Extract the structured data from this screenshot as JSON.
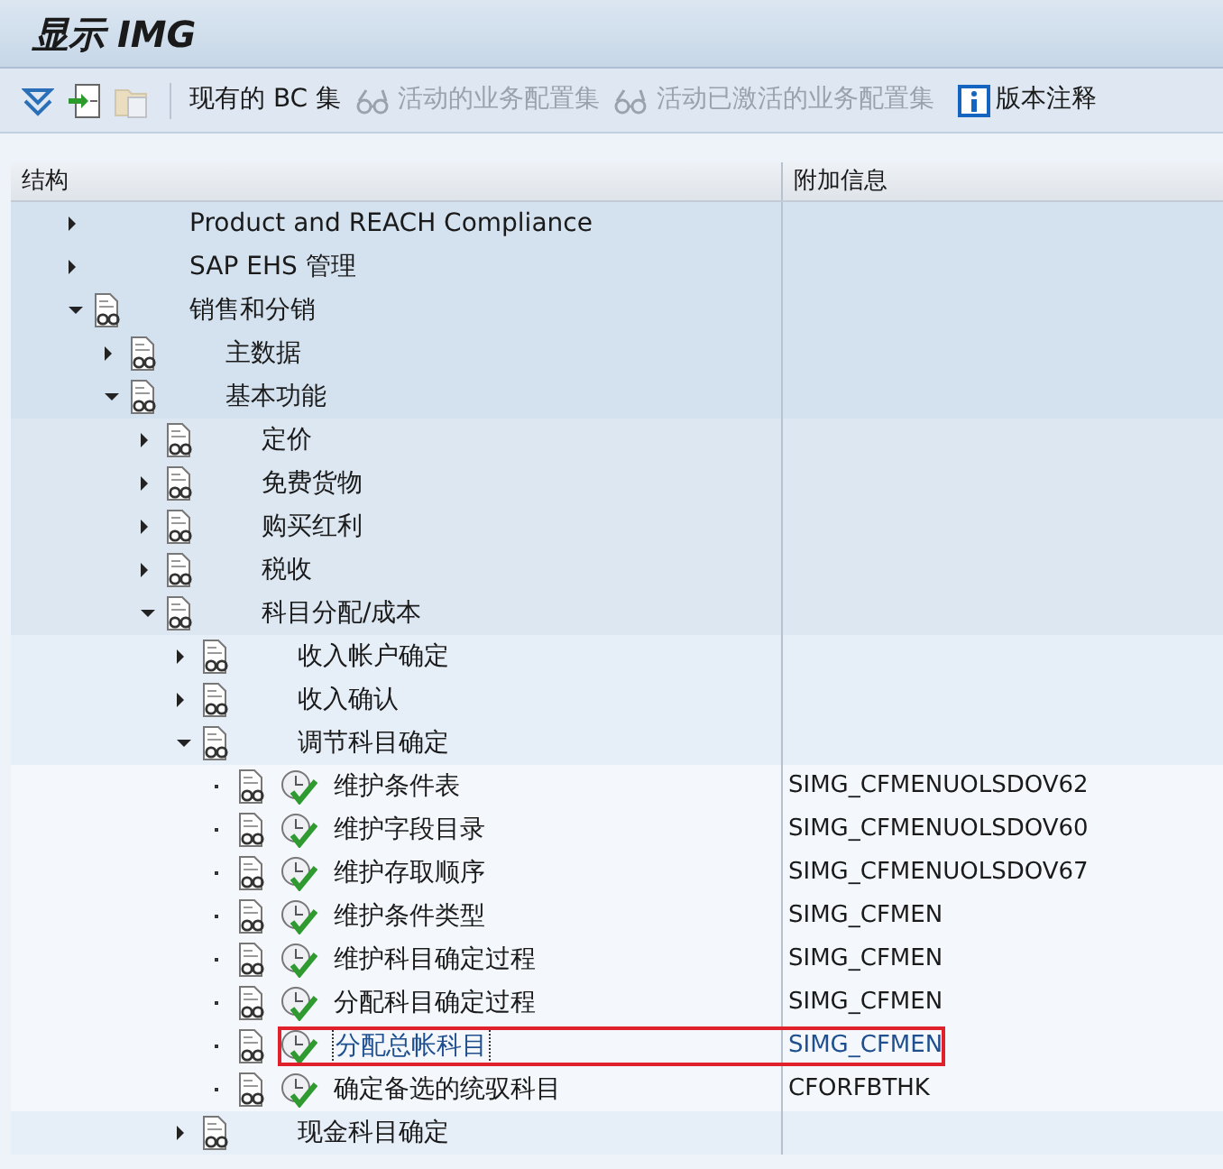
{
  "window": {
    "title": "显示 IMG"
  },
  "toolbar": {
    "buttons": [
      {
        "kind": "expand",
        "disabled": false
      },
      {
        "kind": "enter",
        "disabled": false
      },
      {
        "kind": "folder",
        "disabled": true
      }
    ],
    "actions": [
      {
        "label": "现有的 BC 集",
        "kind": "plain",
        "disabled": false
      },
      {
        "label": "活动的业务配置集",
        "kind": "glasses",
        "disabled": true
      },
      {
        "label": "活动已激活的业务配置集",
        "kind": "glasses",
        "disabled": true
      },
      {
        "label": "版本注释",
        "kind": "info",
        "disabled": false
      }
    ]
  },
  "table": {
    "columns": [
      "结构",
      "附加信息"
    ],
    "rows": [
      {
        "label": "Product and REACH Compliance",
        "kind": "plain",
        "expanded": false
      },
      {
        "label": "SAP EHS 管理",
        "kind": "plain",
        "expanded": false
      },
      {
        "label": "销售和分销",
        "kind": "folder",
        "expanded": true,
        "children": [
          {
            "label": "主数据",
            "kind": "folder",
            "expanded": false
          },
          {
            "label": "基本功能",
            "kind": "folder",
            "expanded": true,
            "children": [
              {
                "label": "定价",
                "kind": "folder",
                "expanded": false
              },
              {
                "label": "免费货物",
                "kind": "folder",
                "expanded": false
              },
              {
                "label": "购买红利",
                "kind": "folder",
                "expanded": false
              },
              {
                "label": "税收",
                "kind": "folder",
                "expanded": false
              },
              {
                "label": "科目分配/成本",
                "kind": "folder",
                "expanded": true,
                "children": [
                  {
                    "label": "收入帐户确定",
                    "kind": "folder",
                    "expanded": false
                  },
                  {
                    "label": "收入确认",
                    "kind": "folder",
                    "expanded": false
                  },
                  {
                    "label": "调节科目确定",
                    "kind": "folder",
                    "expanded": true,
                    "children": [
                      {
                        "label": "维护条件表",
                        "kind": "activity",
                        "info": "SIMG_CFMENUOLSDOV62",
                        "selected": false,
                        "highlighted": false
                      },
                      {
                        "label": "维护字段目录",
                        "kind": "activity",
                        "info": "SIMG_CFMENUOLSDOV60",
                        "selected": false,
                        "highlighted": false
                      },
                      {
                        "label": "维护存取顺序",
                        "kind": "activity",
                        "info": "SIMG_CFMENUOLSDOV67",
                        "selected": false,
                        "highlighted": false
                      },
                      {
                        "label": "维护条件类型",
                        "kind": "activity",
                        "info": "SIMG_CFMEN",
                        "selected": false,
                        "highlighted": false
                      },
                      {
                        "label": "维护科目确定过程",
                        "kind": "activity",
                        "info": "SIMG_CFMEN",
                        "selected": false,
                        "highlighted": false
                      },
                      {
                        "label": "分配科目确定过程",
                        "kind": "activity",
                        "info": "SIMG_CFMEN",
                        "selected": false,
                        "highlighted": false
                      },
                      {
                        "label": "分配总帐科目",
                        "kind": "activity",
                        "info": "SIMG_CFMEN",
                        "selected": true,
                        "highlighted": true
                      },
                      {
                        "label": "确定备选的统驭科目",
                        "kind": "activity",
                        "info": "CFORFBTHK",
                        "selected": false,
                        "highlighted": false
                      }
                    ]
                  },
                  {
                    "label": "现金科目确定",
                    "kind": "folder",
                    "expanded": false
                  }
                ]
              }
            ]
          }
        ]
      }
    ]
  }
}
